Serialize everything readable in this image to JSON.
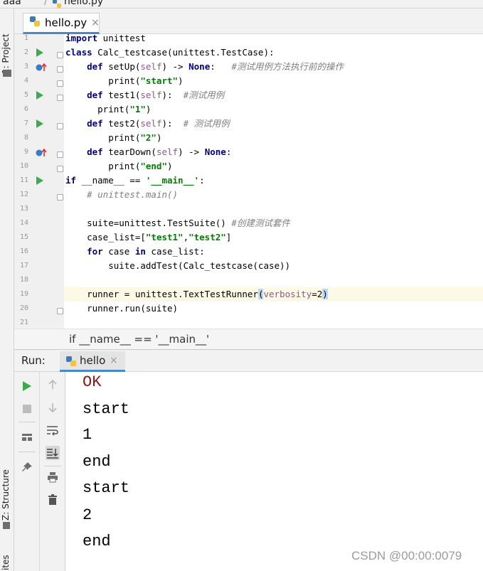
{
  "breadcrumb_top": {
    "project": "aaa",
    "file": "hello.py"
  },
  "left_strip": {
    "project_label": "1: Project",
    "structure_label": "Z: Structure",
    "favorites_label": "ites"
  },
  "editor_tab": {
    "label": "hello.py",
    "close": "×"
  },
  "editor": {
    "line_numbers": [
      "1",
      "2",
      "3",
      "4",
      "5",
      "6",
      "7",
      "8",
      "9",
      "10",
      "11",
      "12",
      "13",
      "14",
      "15",
      "16",
      "17",
      "18",
      "19",
      "20",
      "21"
    ],
    "code_lines": [
      [
        {
          "t": "import",
          "c": "kw"
        },
        {
          "t": " unittest",
          "c": "pl"
        }
      ],
      [
        {
          "t": "class",
          "c": "kw"
        },
        {
          "t": " Calc_testcase(unittest.TestCase):",
          "c": "pl"
        }
      ],
      [
        {
          "t": "    ",
          "c": "pl"
        },
        {
          "t": "def",
          "c": "kw"
        },
        {
          "t": " setUp(",
          "c": "pl"
        },
        {
          "t": "self",
          "c": "sf"
        },
        {
          "t": ") -> ",
          "c": "pl"
        },
        {
          "t": "None",
          "c": "kw"
        },
        {
          "t": ":   ",
          "c": "pl"
        },
        {
          "t": "#测试用例方法执行前的操作",
          "c": "cm"
        }
      ],
      [
        {
          "t": "        print(",
          "c": "pl"
        },
        {
          "t": "\"start\"",
          "c": "str"
        },
        {
          "t": ")",
          "c": "pl"
        }
      ],
      [
        {
          "t": "    ",
          "c": "pl"
        },
        {
          "t": "def",
          "c": "kw"
        },
        {
          "t": " test1(",
          "c": "pl"
        },
        {
          "t": "self",
          "c": "sf"
        },
        {
          "t": "):  ",
          "c": "pl"
        },
        {
          "t": "#测试用例",
          "c": "cm"
        }
      ],
      [
        {
          "t": "      print(",
          "c": "pl"
        },
        {
          "t": "\"1\"",
          "c": "str"
        },
        {
          "t": ")",
          "c": "pl"
        }
      ],
      [
        {
          "t": "    ",
          "c": "pl"
        },
        {
          "t": "def",
          "c": "kw"
        },
        {
          "t": " test2(",
          "c": "pl"
        },
        {
          "t": "self",
          "c": "sf"
        },
        {
          "t": "):  ",
          "c": "pl"
        },
        {
          "t": "# 测试用例",
          "c": "cm"
        }
      ],
      [
        {
          "t": "        print(",
          "c": "pl"
        },
        {
          "t": "\"2\"",
          "c": "str"
        },
        {
          "t": ")",
          "c": "pl"
        }
      ],
      [
        {
          "t": "    ",
          "c": "pl"
        },
        {
          "t": "def",
          "c": "kw"
        },
        {
          "t": " tearDown(",
          "c": "pl"
        },
        {
          "t": "self",
          "c": "sf"
        },
        {
          "t": ") -> ",
          "c": "pl"
        },
        {
          "t": "None",
          "c": "kw"
        },
        {
          "t": ":",
          "c": "pl"
        }
      ],
      [
        {
          "t": "        print(",
          "c": "pl"
        },
        {
          "t": "\"end\"",
          "c": "str"
        },
        {
          "t": ")",
          "c": "pl"
        }
      ],
      [
        {
          "t": "if",
          "c": "kw"
        },
        {
          "t": " __name__ == ",
          "c": "pl"
        },
        {
          "t": "'__main__'",
          "c": "str"
        },
        {
          "t": ":",
          "c": "pl"
        }
      ],
      [
        {
          "t": "    ",
          "c": "pl"
        },
        {
          "t": "# unittest.main()",
          "c": "cm"
        }
      ],
      [],
      [
        {
          "t": "    suite=unittest.TestSuite() ",
          "c": "pl"
        },
        {
          "t": "#创建测试套件",
          "c": "cm"
        }
      ],
      [
        {
          "t": "    case_list=[",
          "c": "pl"
        },
        {
          "t": "\"test1\"",
          "c": "str"
        },
        {
          "t": ",",
          "c": "pl"
        },
        {
          "t": "\"test2\"",
          "c": "str"
        },
        {
          "t": "]",
          "c": "pl"
        }
      ],
      [
        {
          "t": "    ",
          "c": "pl"
        },
        {
          "t": "for",
          "c": "kw"
        },
        {
          "t": " case ",
          "c": "pl"
        },
        {
          "t": "in",
          "c": "kw"
        },
        {
          "t": " case_list:",
          "c": "pl"
        }
      ],
      [
        {
          "t": "        suite.addTest(Calc_testcase(case))",
          "c": "pl"
        }
      ],
      [],
      [
        {
          "t": "    runner = unittest.TextTestRunner",
          "c": "pl"
        },
        {
          "t": "(",
          "c": "hlparen"
        },
        {
          "t": "verbosity",
          "c": "sf"
        },
        {
          "t": "=2",
          "c": "pl"
        },
        {
          "t": ")",
          "c": "hlparen"
        }
      ],
      [
        {
          "t": "    runner.run(suite)",
          "c": "pl"
        }
      ],
      []
    ]
  },
  "editor_breadcrumb": "if __name__ == '__main__'",
  "run_panel": {
    "label": "Run:",
    "tab_label": "hello",
    "tab_close": "×",
    "output_lines": [
      "OK",
      "start",
      "1",
      "end",
      "start",
      "2",
      "end"
    ]
  },
  "watermark": "CSDN @00:00:0079",
  "colors": {
    "keyword": "#000080",
    "string": "#008000",
    "comment": "#808080",
    "self": "#94558d",
    "run_green": "#3daa4e",
    "ok_red": "#8b1a1a"
  }
}
